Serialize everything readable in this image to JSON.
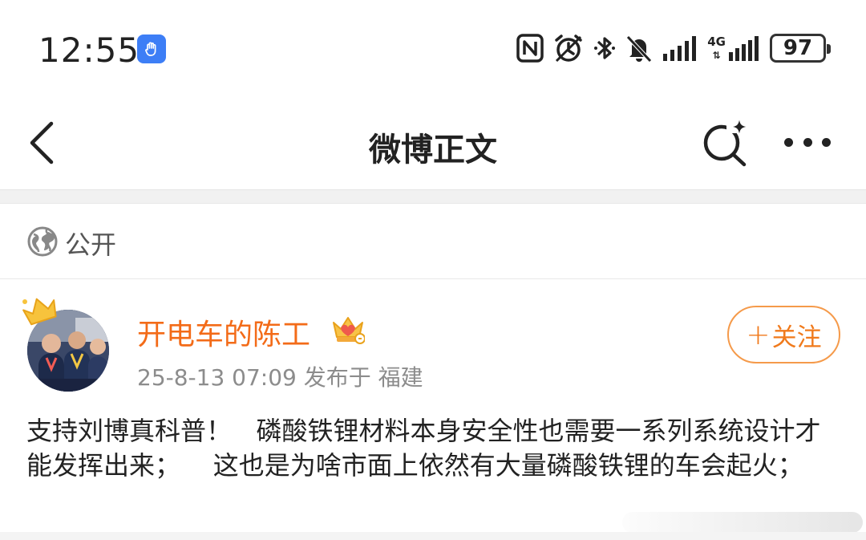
{
  "status_bar": {
    "time": "12:55",
    "network": "4G",
    "battery": "97",
    "icons": [
      "app-badge-hand-icon",
      "nfc-icon",
      "alarm-icon",
      "bluetooth-icon",
      "mute-bell-icon",
      "signal-icon",
      "4g-signal-icon",
      "battery-icon"
    ]
  },
  "nav": {
    "title": "微博正文",
    "icons": [
      "back-arrow-icon",
      "search-sparkle-icon",
      "more-icon"
    ]
  },
  "visibility": {
    "label": "公开",
    "icon": "globe-icon"
  },
  "post": {
    "author": "开电车的陈工",
    "meta": "25-8-13 07:09  发布于 福建",
    "follow_plus": "+",
    "follow_label": "关注",
    "text": "支持刘博真科普！   磷酸铁锂材料本身安全性也需要一系列系统设计才能发挥出来；    这也是为啥市面上依然有大量磷酸铁锂的车会起火；"
  },
  "colors": {
    "accent": "#f36b18",
    "follow_border": "#f59a4a",
    "meta": "#8c8c8c",
    "badge_blue": "#3d7ef6"
  }
}
